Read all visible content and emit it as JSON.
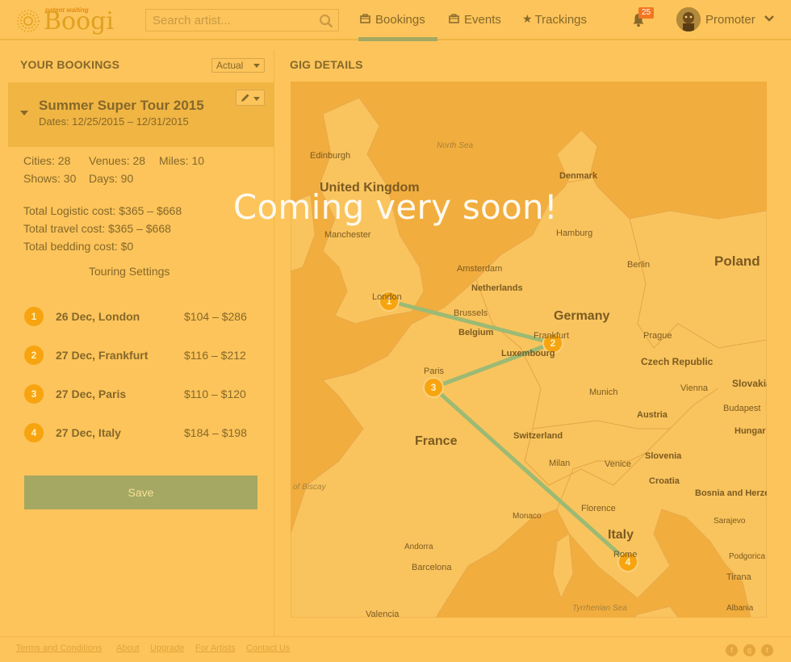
{
  "header": {
    "logo_text": "Boogi",
    "logo_tag": "patent waiting",
    "search_placeholder": "Search artist...",
    "nav": [
      {
        "label": "Bookings",
        "icon": "briefcase-icon",
        "active": true
      },
      {
        "label": "Events",
        "icon": "calendar-icon",
        "active": false
      },
      {
        "label": "Trackings",
        "icon": "star-icon",
        "active": false
      }
    ],
    "notifications_count": "25",
    "user_label": "Promoter"
  },
  "left": {
    "title": "YOUR BOOKINGS",
    "filter_selected": "Actual",
    "tour": {
      "name": "Summer Super Tour 2015",
      "dates": "Dates: 12/25/2015 – 12/31/2015"
    },
    "stats": {
      "cities": "Cities: 28",
      "venues": "Venues: 28",
      "miles": "Miles: 10",
      "shows": "Shows: 30",
      "days": "Days: 90",
      "logistic": "Total Logistic cost: $365 – $668",
      "travel": "Total travel cost: $365 – $668",
      "bedding": "Total bedding cost: $0"
    },
    "touring_settings": "Touring Settings",
    "stops": [
      {
        "num": "1",
        "name": "26 Dec, London",
        "price": "$104 – $286"
      },
      {
        "num": "2",
        "name": "27 Dec, Frankfurt",
        "price": "$116 – $212"
      },
      {
        "num": "3",
        "name": "27 Dec, Paris",
        "price": "$110 – $120"
      },
      {
        "num": "4",
        "name": "27 Dec, Italy",
        "price": "$184 – $198"
      }
    ],
    "save_label": "Save"
  },
  "right": {
    "title": "GIG DETAILS",
    "overlay_text": "Coming very soon!",
    "map": {
      "countries": [
        "Poland",
        "Germany",
        "France",
        "Italy",
        "Czech Republic",
        "Slovakia",
        "Austria",
        "Switzerland",
        "Slovenia",
        "Croatia",
        "Bosnia and Herzegovina",
        "Hungar",
        "Denmark",
        "United Kingdom",
        "Belgium",
        "Luxembourg",
        "Netherlands",
        "Monaco",
        "Andorra",
        "Albania"
      ],
      "cities": [
        "Edinburgh",
        "Manchester",
        "London",
        "Hamburg",
        "Berlin",
        "Amsterdam",
        "Brussels",
        "Frankfurt",
        "Prague",
        "Paris",
        "Munich",
        "Vienna",
        "Budapest",
        "Milan",
        "Venice",
        "Florence",
        "Rome",
        "Barcelona",
        "Valencia",
        "Sarajevo",
        "Podgorica",
        "Tirana"
      ],
      "seas": [
        "North Sea",
        "Tyrrhenian Sea",
        "of Biscay"
      ],
      "markers": [
        "1",
        "2",
        "3",
        "4"
      ]
    }
  },
  "footer": {
    "links": [
      "Terms and Conditions",
      "About",
      "Upgrade",
      "For Artists",
      "Contact Us"
    ],
    "social": [
      "facebook-icon",
      "google-plus-icon",
      "twitter-icon"
    ]
  },
  "colors": {
    "background": "#fcc45a",
    "text": "#86682a",
    "accent": "#a4a862",
    "marker": "#f7a410",
    "route": "#9cba74"
  }
}
